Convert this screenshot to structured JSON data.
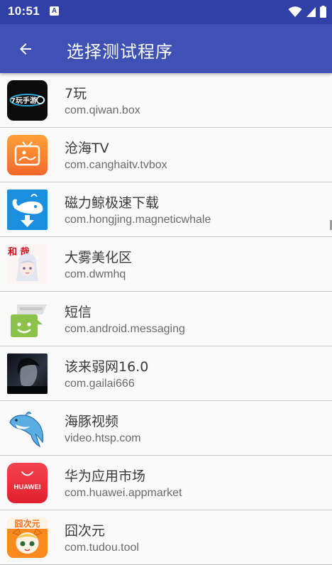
{
  "status_bar": {
    "time": "10:51",
    "notification_glyph": "A"
  },
  "app_bar": {
    "title": "选择测试程序"
  },
  "apps": [
    {
      "name": "7玩",
      "package": "com.qiwan.box",
      "icon": "qiwan-icon",
      "icon_text": "7玩手游"
    },
    {
      "name": "沧海TV",
      "package": "com.canghaitv.tvbox",
      "icon": "canghai-tv-icon"
    },
    {
      "name": "磁力鲸极速下载",
      "package": "com.hongjing.magneticwhale",
      "icon": "whale-download-icon"
    },
    {
      "name": "大雾美化区",
      "package": "com.dwmhq",
      "icon": "anime-girl-icon",
      "icon_text": "和 哉"
    },
    {
      "name": "短信",
      "package": "com.android.messaging",
      "icon": "messaging-icon"
    },
    {
      "name": "该来弱网16.0",
      "package": "com.gailai666",
      "icon": "dark-portrait-icon"
    },
    {
      "name": "海豚视频",
      "package": "video.htsp.com",
      "icon": "dolphin-icon"
    },
    {
      "name": "华为应用市场",
      "package": "com.huawei.appmarket",
      "icon": "huawei-appgallery-icon",
      "icon_text": "HUAWEI"
    },
    {
      "name": "囧次元",
      "package": "com.tudou.tool",
      "icon": "jiongciyuan-icon",
      "icon_text": "囧次元"
    }
  ]
}
